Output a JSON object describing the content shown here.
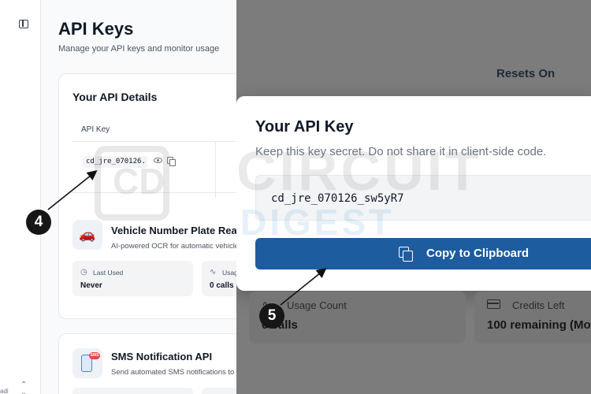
{
  "sidebar": {
    "edge_text": "adi"
  },
  "page": {
    "title": "API Keys",
    "subtitle": "Manage your API keys and monitor usage",
    "details_card": {
      "title": "Your API Details",
      "column_header": "API Key",
      "masked_key": "cd_jre_070126..."
    },
    "service": {
      "name": "Vehicle Number Plate Reader",
      "description": "AI-powered OCR for automatic vehicle",
      "last_used_label": "Last Used",
      "last_used_value": "Never",
      "usage_label": "Usage Count",
      "usage_value": "0 calls"
    },
    "sms_service": {
      "name": "SMS Notification API",
      "description": "Send automated SMS notifications to",
      "badge": "SMS"
    }
  },
  "zoom": {
    "resets_label": "Resets On",
    "modal": {
      "title": "Your API Key",
      "subtitle": "Keep this key secret. Do not share it in client-side code.",
      "key_value": "cd_jre_070126_sw5yR7",
      "copy_button": "Copy to Clipboard"
    },
    "usage_label": "Usage Count",
    "usage_value": "0 calls",
    "credits_label": "Credits Left",
    "credits_value": "100 remaining (Mo"
  },
  "steps": {
    "step4": "4",
    "step5": "5"
  },
  "watermark": {
    "line1": "CIRCUIT",
    "line2": "DIGEST",
    "logo": "CD"
  },
  "colors": {
    "primary_button": "#1d5c9e",
    "overlay": "#7c7c7c",
    "step_marker": "#161616"
  },
  "icons": [
    "sidebar-toggle-icon",
    "eye-icon",
    "copy-icon",
    "car-icon",
    "phone-sms-icon",
    "clock-icon",
    "activity-icon",
    "credit-card-icon",
    "chevron-updown-icon"
  ]
}
